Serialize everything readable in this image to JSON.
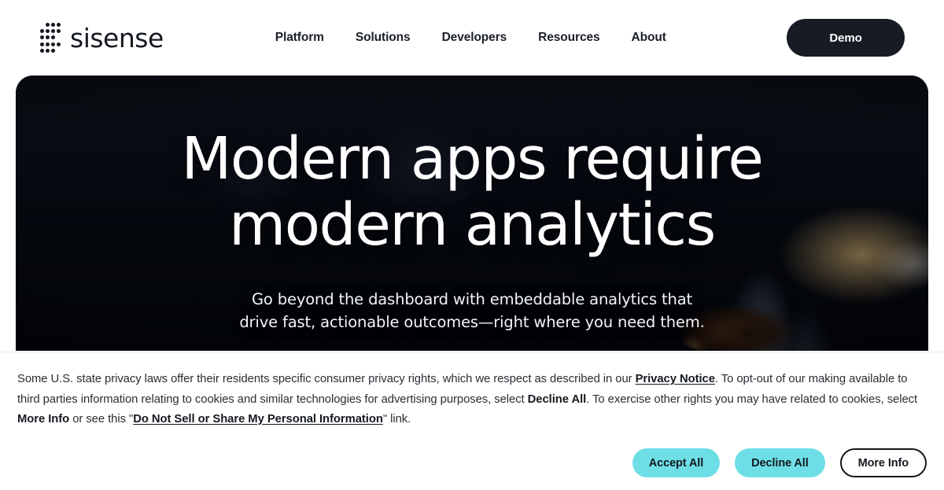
{
  "header": {
    "logo": {
      "icon": "sisense-dot-grid-logo",
      "wordmark": "sisense"
    },
    "nav": [
      {
        "label": "Platform"
      },
      {
        "label": "Solutions"
      },
      {
        "label": "Developers"
      },
      {
        "label": "Resources"
      },
      {
        "label": "About"
      }
    ],
    "cta": {
      "label": "Demo",
      "bg_color": "#171b23",
      "text_color": "#ffffff"
    }
  },
  "hero": {
    "title_line1": "Modern apps require",
    "title_line2": "modern analytics",
    "subtitle_line1": "Go beyond the dashboard with embeddable analytics that",
    "subtitle_line2": "drive fast, actionable outcomes—right where you need them.",
    "background": "dark blurred night city skyline with bokeh lights and person silhouette"
  },
  "cookie_banner": {
    "paragraph": {
      "p1": "Some U.S. state privacy laws offer their residents specific consumer privacy rights, which we respect as described in our ",
      "link1": "Privacy Notice",
      "p2": ". To opt-out of our making available to third parties information relating to cookies and similar technologies for advertising purposes, select ",
      "bold1": "Decline All",
      "p3": ". To exercise other rights you may have related to cookies, select ",
      "bold2": "More Info",
      "p4": " or see this \"",
      "link2": "Do Not Sell or Share My Personal Information",
      "p5": "\" link."
    },
    "buttons": [
      {
        "label": "Accept All",
        "style": "accent",
        "color": "#6EDEE6"
      },
      {
        "label": "Decline All",
        "style": "accent",
        "color": "#6EDEE6"
      },
      {
        "label": "More Info",
        "style": "outline",
        "color": "#ffffff"
      }
    ]
  }
}
